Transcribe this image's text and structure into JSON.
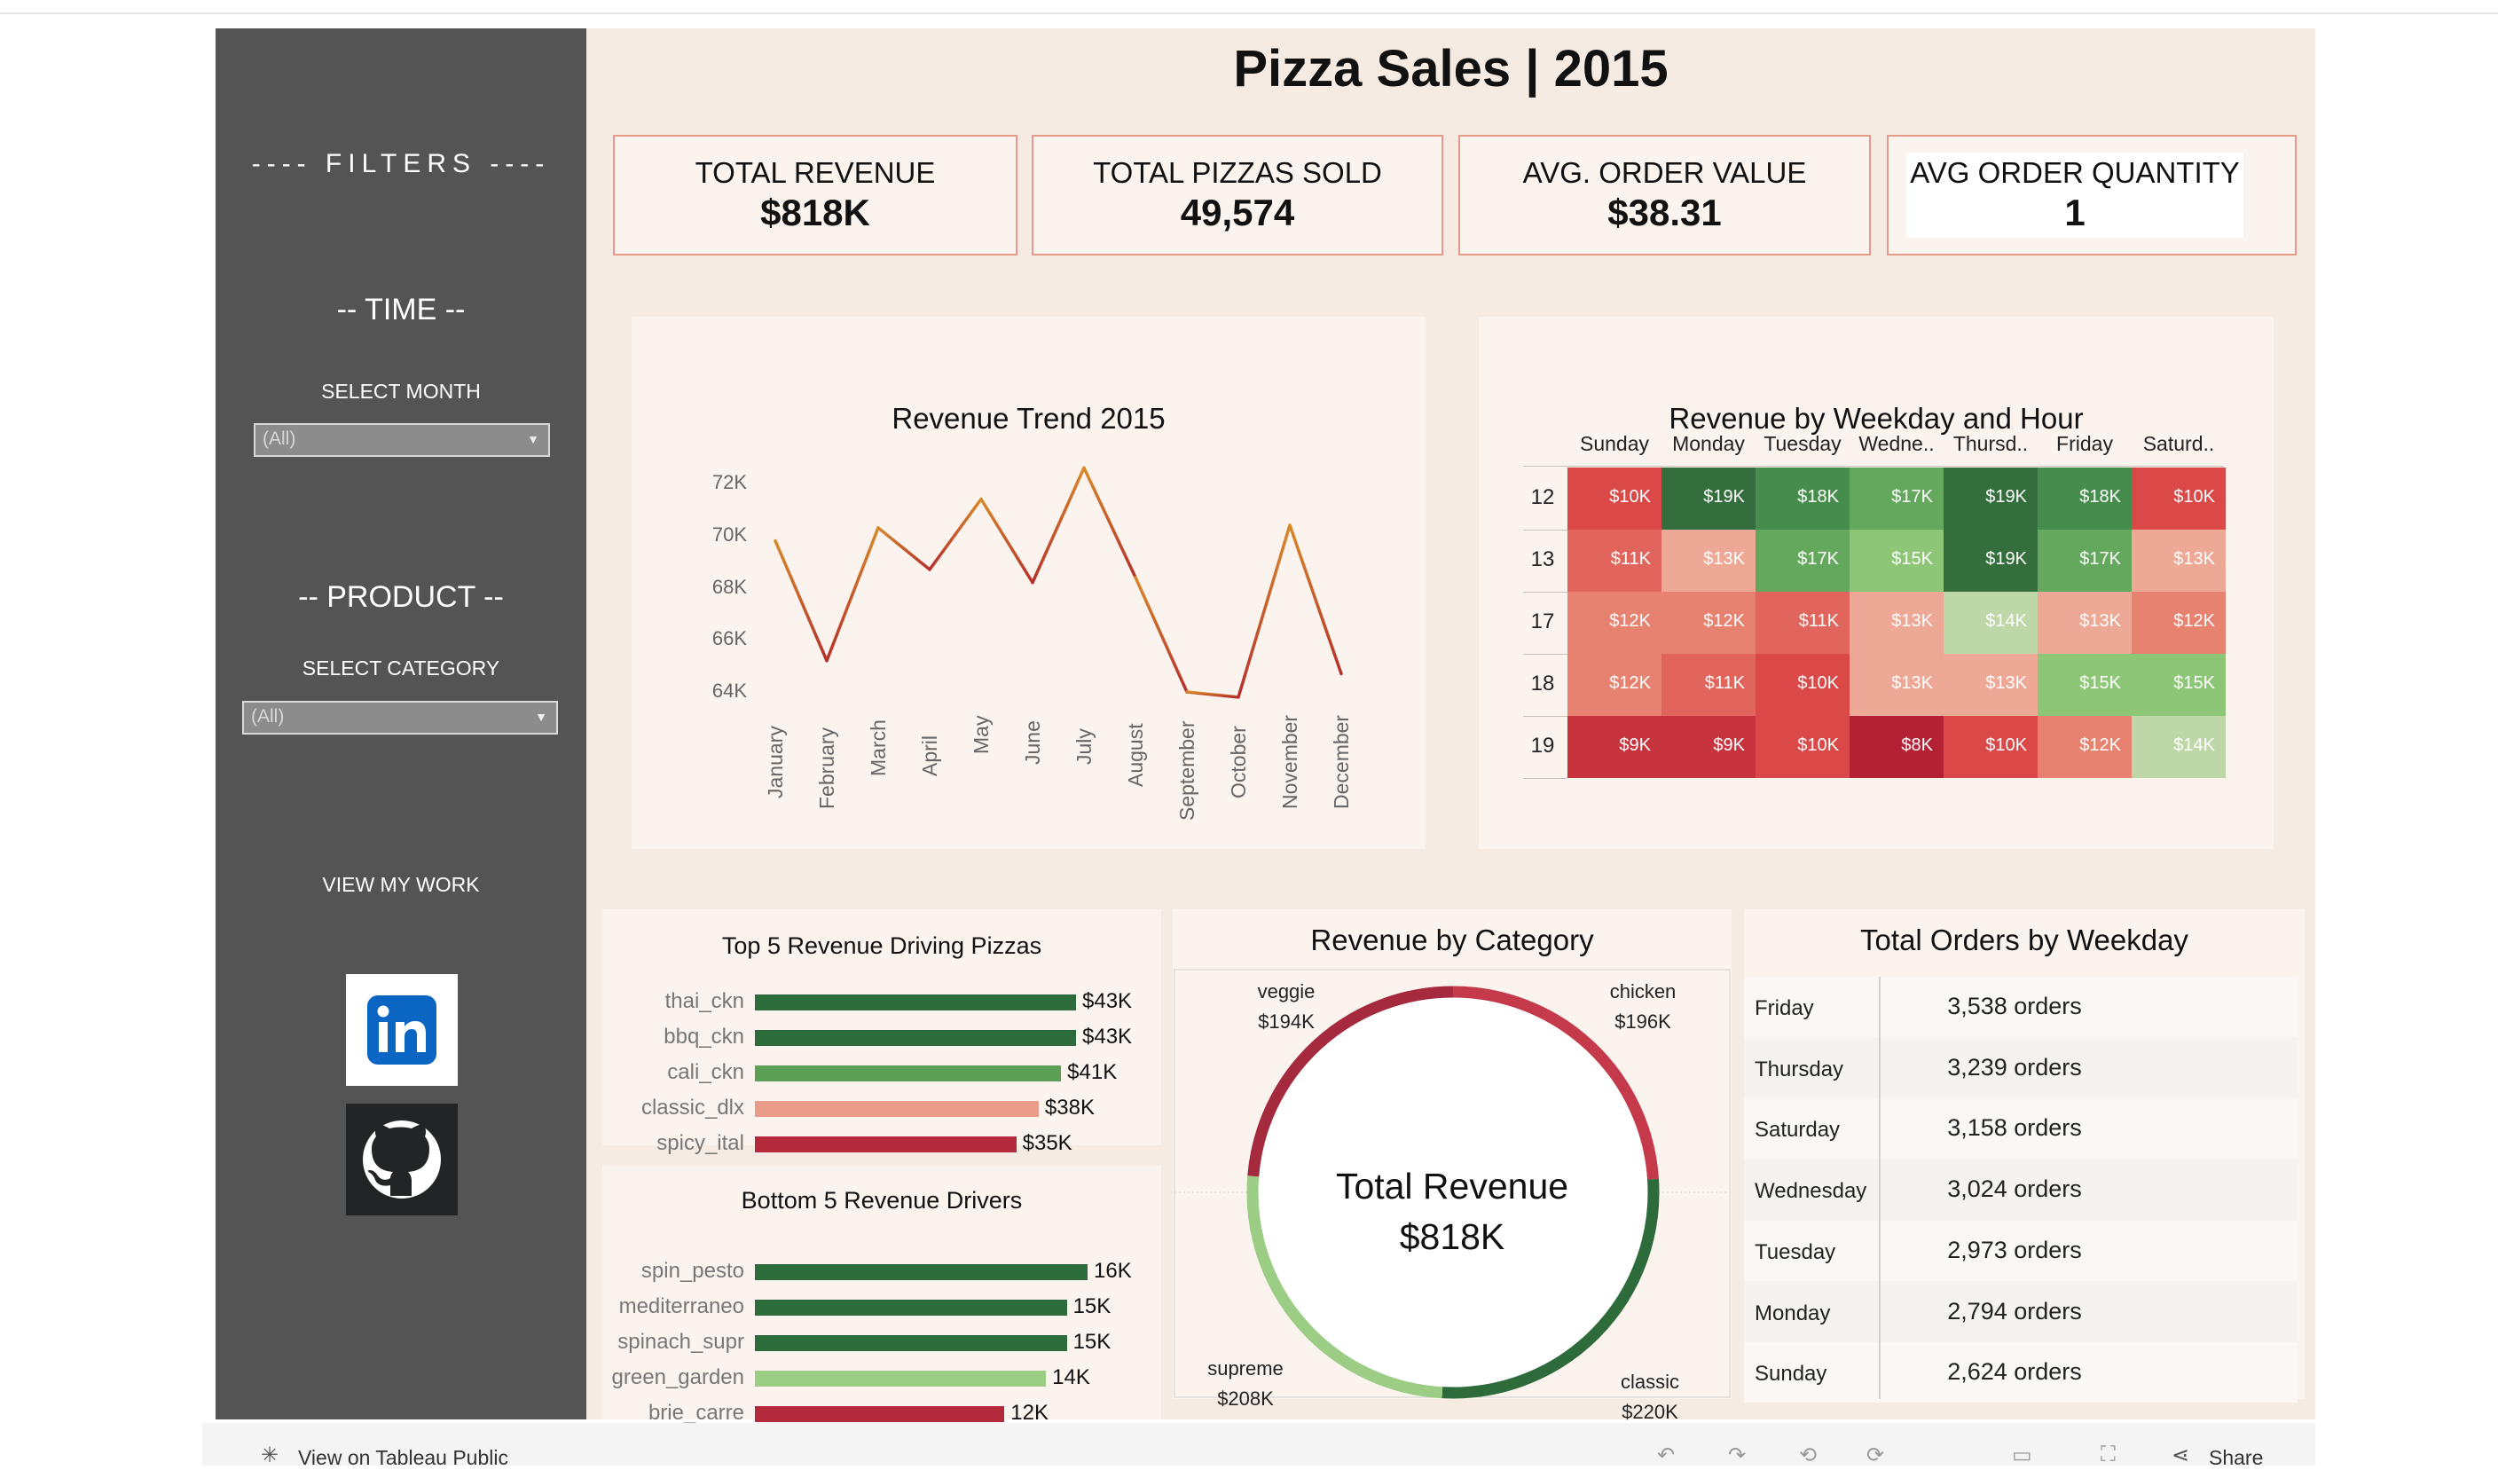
{
  "sidebar": {
    "filters": "---- FILTERS ----",
    "time": "-- TIME --",
    "select_month": "SELECT MONTH",
    "month_value": "(All)",
    "product": "-- PRODUCT --",
    "select_category": "SELECT CATEGORY",
    "category_value": "(All)",
    "view_work": "VIEW MY WORK"
  },
  "title": "Pizza Sales | 2015",
  "kpis": [
    {
      "label": "TOTAL REVENUE",
      "value": "$818K"
    },
    {
      "label": "TOTAL PIZZAS SOLD",
      "value": "49,574"
    },
    {
      "label": "AVG. ORDER VALUE",
      "value": "$38.31"
    },
    {
      "label": "AVG ORDER QUANTITY",
      "value": "1"
    }
  ],
  "panels": {
    "revenue_trend": "Revenue Trend 2015",
    "heatmap": "Revenue by Weekday and Hour",
    "top5": "Top 5 Revenue Driving Pizzas",
    "bottom5": "Bottom 5 Revenue Drivers",
    "category": "Revenue by Category",
    "orders": "Total Orders by Weekday"
  },
  "donut_center": {
    "label": "Total Revenue",
    "value": "$818K"
  },
  "orders_by_weekday": {
    "unit": "orders",
    "rows": [
      {
        "day": "Friday",
        "value": "3,538"
      },
      {
        "day": "Thursday",
        "value": "3,239"
      },
      {
        "day": "Saturday",
        "value": "3,158"
      },
      {
        "day": "Wednesday",
        "value": "3,024"
      },
      {
        "day": "Tuesday",
        "value": "2,973"
      },
      {
        "day": "Monday",
        "value": "2,794"
      },
      {
        "day": "Sunday",
        "value": "2,624"
      }
    ]
  },
  "bottombar": {
    "view_label": "View on Tableau Public",
    "share_label": "Share"
  },
  "colors": {
    "dark_green": "#2e6b3b",
    "mid_green": "#5d9e57",
    "light_green": "#9bcd84",
    "salmon": "#e99c8a",
    "crimson": "#b22a3c",
    "line_red": "#b5312c",
    "line_orange": "#d78a2c"
  },
  "chart_data": [
    {
      "type": "line",
      "title": "Revenue Trend 2015",
      "x": [
        "January",
        "February",
        "March",
        "April",
        "May",
        "June",
        "July",
        "August",
        "September",
        "October",
        "November",
        "December"
      ],
      "values": [
        69800,
        65200,
        70300,
        68700,
        71400,
        68200,
        72600,
        68400,
        64000,
        63800,
        70400,
        64700
      ],
      "yticks": [
        "64K",
        "66K",
        "68K",
        "70K",
        "72K"
      ],
      "ylim": [
        64000,
        72000
      ]
    },
    {
      "type": "heatmap",
      "title": "Revenue by Weekday and Hour",
      "columns": [
        "Sunday",
        "Monday",
        "Tuesday",
        "Wedne..",
        "Thursd..",
        "Friday",
        "Saturd.."
      ],
      "rows": [
        "12",
        "13",
        "17",
        "18",
        "19"
      ],
      "values": [
        [
          10,
          19,
          18,
          17,
          19,
          18,
          10
        ],
        [
          11,
          13,
          17,
          15,
          19,
          17,
          13
        ],
        [
          12,
          12,
          11,
          13,
          14,
          13,
          12
        ],
        [
          12,
          11,
          10,
          13,
          13,
          15,
          15
        ],
        [
          9,
          9,
          10,
          8,
          10,
          12,
          14
        ]
      ],
      "labels": [
        [
          "$10K",
          "$19K",
          "$18K",
          "$17K",
          "$19K",
          "$18K",
          "$10K"
        ],
        [
          "$11K",
          "$13K",
          "$17K",
          "$15K",
          "$19K",
          "$17K",
          "$13K"
        ],
        [
          "$12K",
          "$12K",
          "$11K",
          "$13K",
          "$14K",
          "$13K",
          "$12K"
        ],
        [
          "$12K",
          "$11K",
          "$10K",
          "$13K",
          "$13K",
          "$15K",
          "$15K"
        ],
        [
          "$9K",
          "$9K",
          "$10K",
          "$8K",
          "$10K",
          "$12K",
          "$14K"
        ]
      ]
    },
    {
      "type": "bar",
      "title": "Top 5 Revenue Driving Pizzas",
      "categories": [
        "thai_ckn",
        "bbq_ckn",
        "cali_ckn",
        "classic_dlx",
        "spicy_ital"
      ],
      "values": [
        43,
        43,
        41,
        38,
        35
      ],
      "labels": [
        "$43K",
        "$43K",
        "$41K",
        "$38K",
        "$35K"
      ]
    },
    {
      "type": "bar",
      "title": "Bottom 5 Revenue Drivers",
      "categories": [
        "spin_pesto",
        "mediterraneo",
        "spinach_supr",
        "green_garden",
        "brie_carre"
      ],
      "values": [
        16,
        15,
        15,
        14,
        12
      ],
      "labels": [
        "16K",
        "15K",
        "15K",
        "14K",
        "12K"
      ]
    },
    {
      "type": "pie",
      "title": "Revenue by Category",
      "categories": [
        "chicken",
        "classic",
        "supreme",
        "veggie"
      ],
      "values": [
        196,
        220,
        208,
        194
      ],
      "labels": [
        "$196K",
        "$220K",
        "$208K",
        "$194K"
      ]
    }
  ]
}
